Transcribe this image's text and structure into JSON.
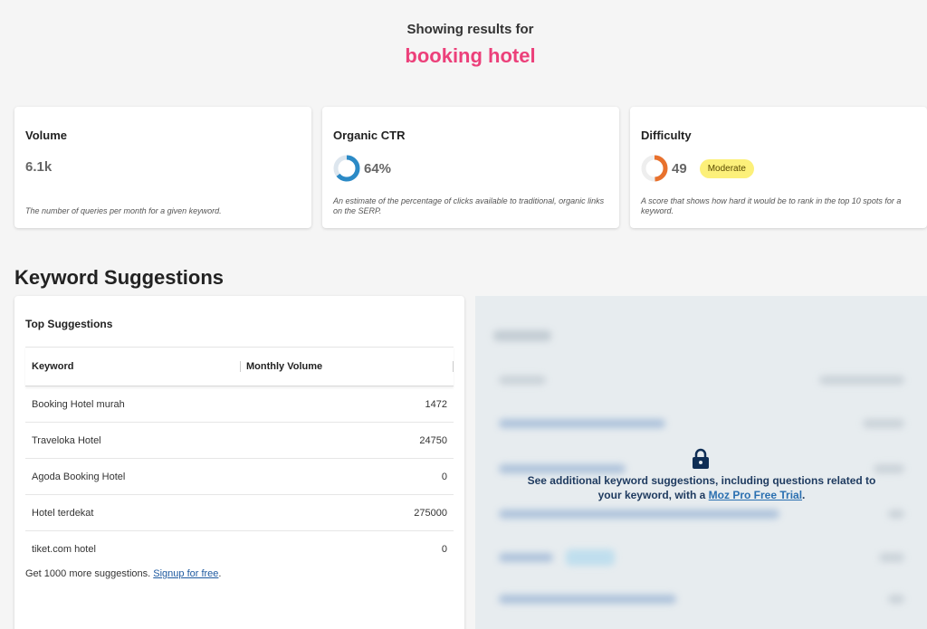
{
  "header": {
    "subtitle": "Showing results for",
    "keyword": "booking hotel"
  },
  "metrics": {
    "volume": {
      "title": "Volume",
      "value": "6.1k",
      "description": "The number of queries per month for a given keyword."
    },
    "ctr": {
      "title": "Organic CTR",
      "value": "64%",
      "percent": 64,
      "description": "An estimate of the percentage of clicks available to traditional, organic links on the SERP.",
      "color": "#2b8ac6"
    },
    "difficulty": {
      "title": "Difficulty",
      "value": "49",
      "score": 49,
      "badge": "Moderate",
      "description": "A score that shows how hard it would be to rank in the top 10 spots for a keyword.",
      "color": "#e8712d"
    }
  },
  "section_title": "Keyword Suggestions",
  "suggestions": {
    "title": "Top Suggestions",
    "columns": [
      "Keyword",
      "Monthly Volume"
    ],
    "rows": [
      {
        "keyword": "Booking Hotel murah",
        "volume": "1472"
      },
      {
        "keyword": "Traveloka Hotel",
        "volume": "24750"
      },
      {
        "keyword": "Agoda Booking Hotel",
        "volume": "0"
      },
      {
        "keyword": "Hotel terdekat",
        "volume": "275000"
      },
      {
        "keyword": "tiket.com hotel",
        "volume": "0"
      }
    ],
    "footer_text": "Get 1000 more suggestions.",
    "footer_link": "Signup for free",
    "footer_end": "."
  },
  "locked_panel": {
    "message": "See additional keyword suggestions, including questions related to your keyword, with a",
    "link": "Moz Pro Free Trial",
    "message_end": "."
  },
  "colors": {
    "accent": "#ec407a",
    "badge": "#fcf07a",
    "link": "#1e5aa0"
  }
}
